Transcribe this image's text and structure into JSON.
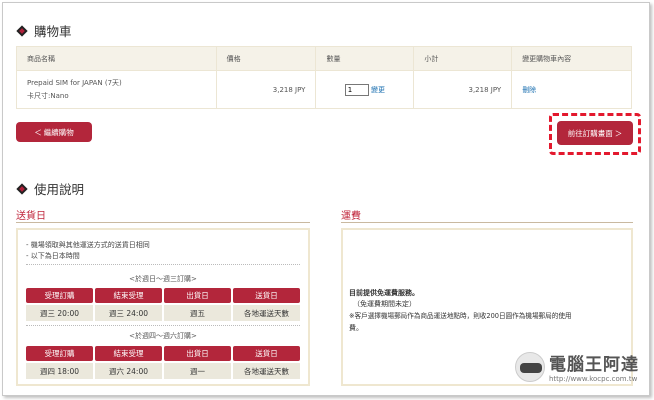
{
  "cart": {
    "title": "購物車",
    "headers": [
      "商品名稱",
      "價格",
      "數量",
      "小計",
      "變更購物車內容"
    ],
    "item": {
      "name": "Prepaid SIM for JAPAN (7天)",
      "size": "卡尺寸:Nano",
      "price": "3,218 JPY",
      "qty": "1",
      "update": "變更",
      "subtotal": "3,218 JPY",
      "delete": "刪除"
    },
    "continue_button": "＜ 繼續購物",
    "checkout_button": "前往訂購畫面 ＞"
  },
  "usage": {
    "title": "使用說明",
    "delivery_title": "送貨日",
    "shipping_title": "運費",
    "bullets": [
      "- 機場領取與其他運送方式的送貨日相同",
      "- 以下為日本時間"
    ],
    "group1_label": "<於週日〜週三訂購>",
    "group2_label": "<於週四〜週六訂購>",
    "grid_headers": [
      "受理訂購",
      "結束受理",
      "出貨日",
      "送貨日"
    ],
    "group1_row": [
      "週三 20:00",
      "週三 24:00",
      "週五",
      "各地運送天數"
    ],
    "group2_row": [
      "週四 18:00",
      "週六 24:00",
      "週一",
      "各地運送天數"
    ],
    "shipping_lines": [
      "目前提供免運費服務。",
      "（免運費期間未定）",
      "※客戶選擇機場郵局作為商品運送地點時，則收200日圓作為機場郵局的使用",
      "費。"
    ]
  },
  "watermark": {
    "name": "電腦王阿達",
    "url": "http://www.kocpc.com.tw"
  },
  "colors": {
    "accent": "#b3263b",
    "highlight": "#e3182d",
    "header_bg": "#f5f2e8",
    "link": "#1a6fb0"
  }
}
